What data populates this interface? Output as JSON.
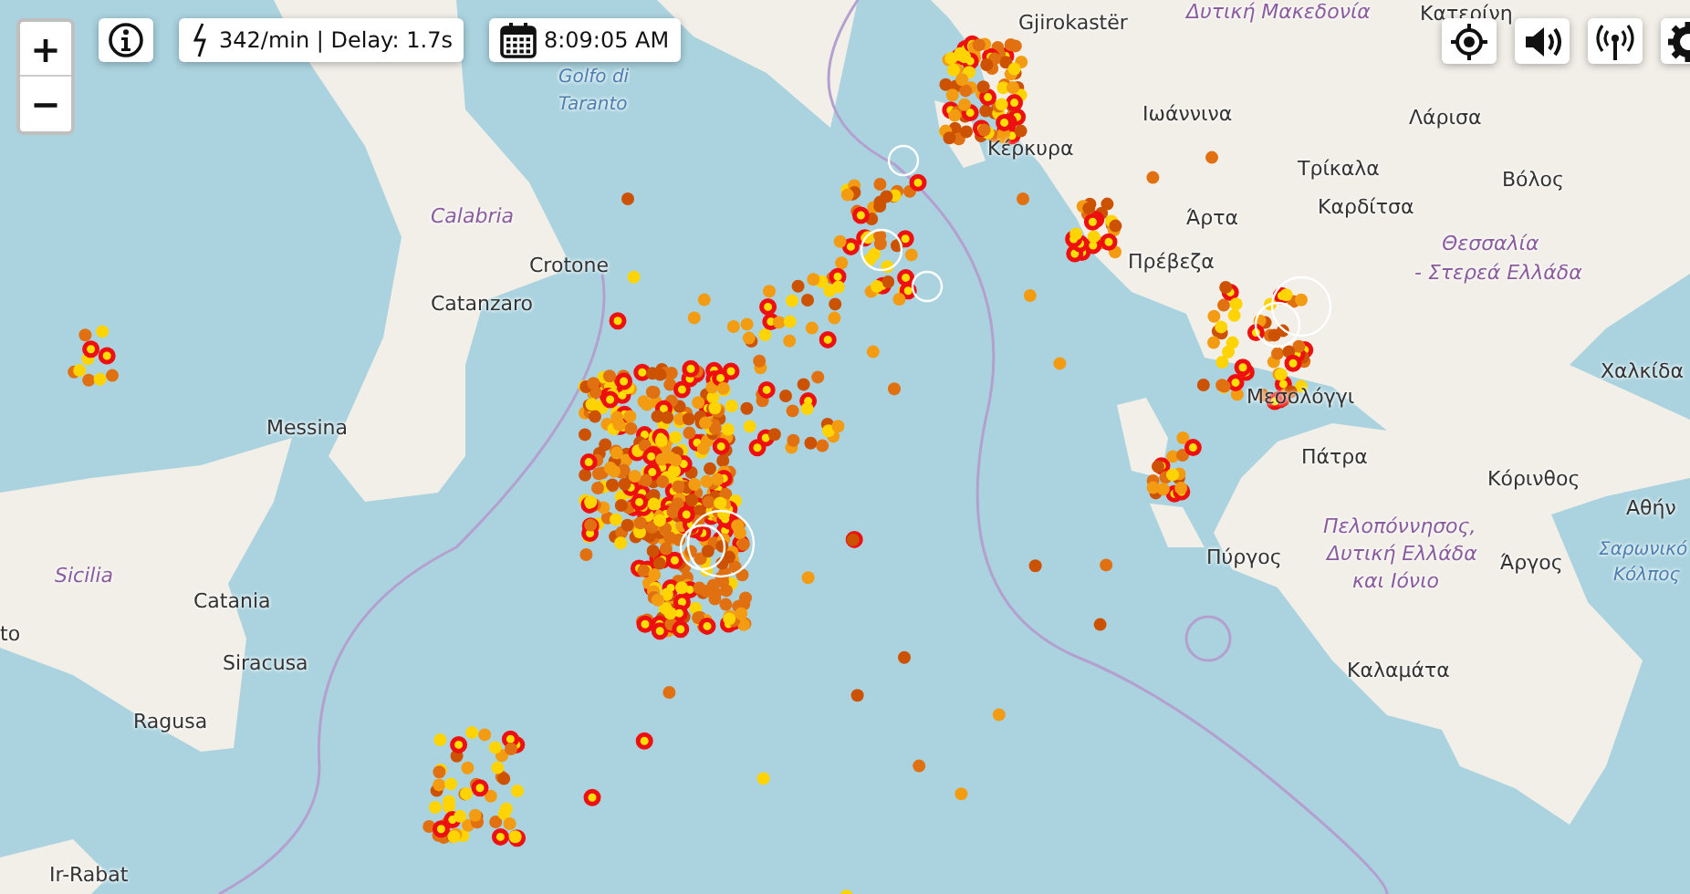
{
  "zoom_control": {
    "zoom_in": "+",
    "zoom_out": "−"
  },
  "stats": {
    "text": "342/min | Delay: 1.7s"
  },
  "clock": {
    "time": "8:09:05 AM"
  },
  "toolbar_right": [
    {
      "kind": "locate"
    },
    {
      "kind": "sound"
    },
    {
      "kind": "antenna"
    },
    {
      "kind": "settings"
    }
  ],
  "map": {
    "labels": [
      {
        "text": "Δυτική Μακεδονία",
        "kind": "region"
      },
      {
        "text": "Κατερίνη",
        "kind": "city"
      },
      {
        "text": "Gjirokastër",
        "kind": "city"
      },
      {
        "text": "Golfo di",
        "kind": "water"
      },
      {
        "text": "Taranto",
        "kind": "water"
      },
      {
        "text": "Ιωάννινα",
        "kind": "city"
      },
      {
        "text": "Λάρισα",
        "kind": "city"
      },
      {
        "text": "Κέρκυρα",
        "kind": "city"
      },
      {
        "text": "Τρίκαλα",
        "kind": "city"
      },
      {
        "text": "Βόλος",
        "kind": "city"
      },
      {
        "text": "Καρδίτσα",
        "kind": "city"
      },
      {
        "text": "Calabria",
        "kind": "region"
      },
      {
        "text": "Άρτα",
        "kind": "city"
      },
      {
        "text": "Θεσσαλία",
        "kind": "region"
      },
      {
        "text": "Πρέβεζα",
        "kind": "city"
      },
      {
        "text": "Crotone",
        "kind": "city"
      },
      {
        "text": "- Στερεά Ελλάδα",
        "kind": "region"
      },
      {
        "text": "Catanzaro",
        "kind": "city"
      },
      {
        "text": "Χαλκίδα",
        "kind": "city"
      },
      {
        "text": "Μεσολόγγι",
        "kind": "city"
      },
      {
        "text": "Messina",
        "kind": "city"
      },
      {
        "text": "Πάτρα",
        "kind": "city"
      },
      {
        "text": "Κόρινθος",
        "kind": "city"
      },
      {
        "text": "Αθήν",
        "kind": "city"
      },
      {
        "text": "Πελοπόννησος,",
        "kind": "region"
      },
      {
        "text": "Πύργος",
        "kind": "city"
      },
      {
        "text": "Δυτική Ελλάδα",
        "kind": "region"
      },
      {
        "text": "Άργος",
        "kind": "city"
      },
      {
        "text": "Σαρωνικό",
        "kind": "water"
      },
      {
        "text": "Sicilia",
        "kind": "region"
      },
      {
        "text": "και Ιόνιο",
        "kind": "region"
      },
      {
        "text": "Κόλπος",
        "kind": "water"
      },
      {
        "text": "Catania",
        "kind": "city"
      },
      {
        "text": "to",
        "kind": "city"
      },
      {
        "text": "Siracusa",
        "kind": "city"
      },
      {
        "text": "Καλαμάτα",
        "kind": "city"
      },
      {
        "text": "Ragusa",
        "kind": "city"
      },
      {
        "text": "Ir-Rabat",
        "kind": "city"
      }
    ]
  }
}
